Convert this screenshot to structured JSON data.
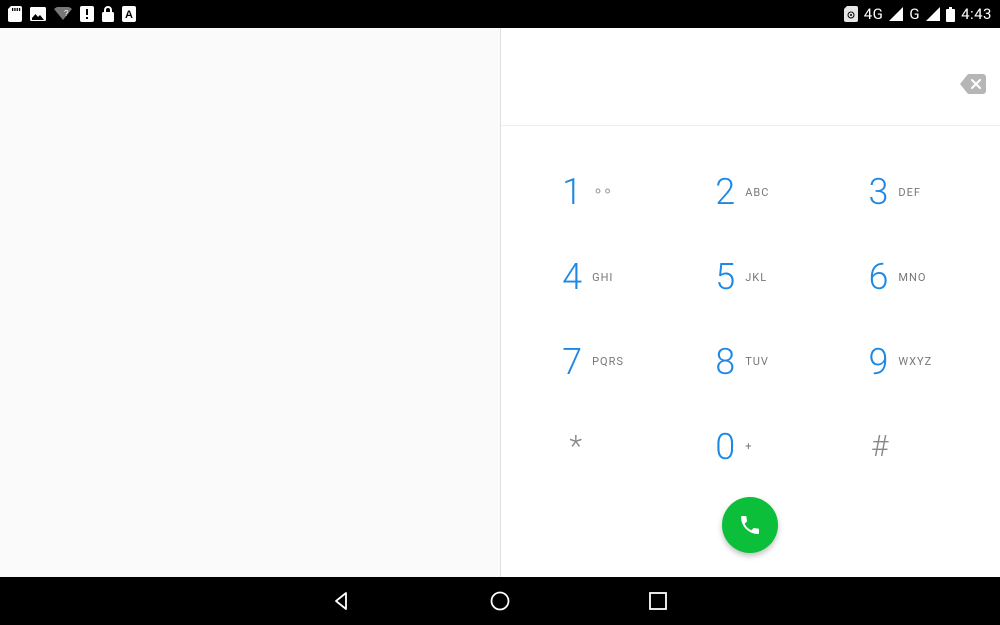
{
  "status": {
    "time": "4:43",
    "net1": "4G",
    "net2": "G"
  },
  "dialpad": {
    "keys": [
      {
        "digit": "1",
        "letters": ""
      },
      {
        "digit": "2",
        "letters": "ABC"
      },
      {
        "digit": "3",
        "letters": "DEF"
      },
      {
        "digit": "4",
        "letters": "GHI"
      },
      {
        "digit": "5",
        "letters": "JKL"
      },
      {
        "digit": "6",
        "letters": "MNO"
      },
      {
        "digit": "7",
        "letters": "PQRS"
      },
      {
        "digit": "8",
        "letters": "TUV"
      },
      {
        "digit": "9",
        "letters": "WXYZ"
      },
      {
        "digit": "*",
        "letters": ""
      },
      {
        "digit": "0",
        "letters": "+"
      },
      {
        "digit": "#",
        "letters": ""
      }
    ]
  }
}
